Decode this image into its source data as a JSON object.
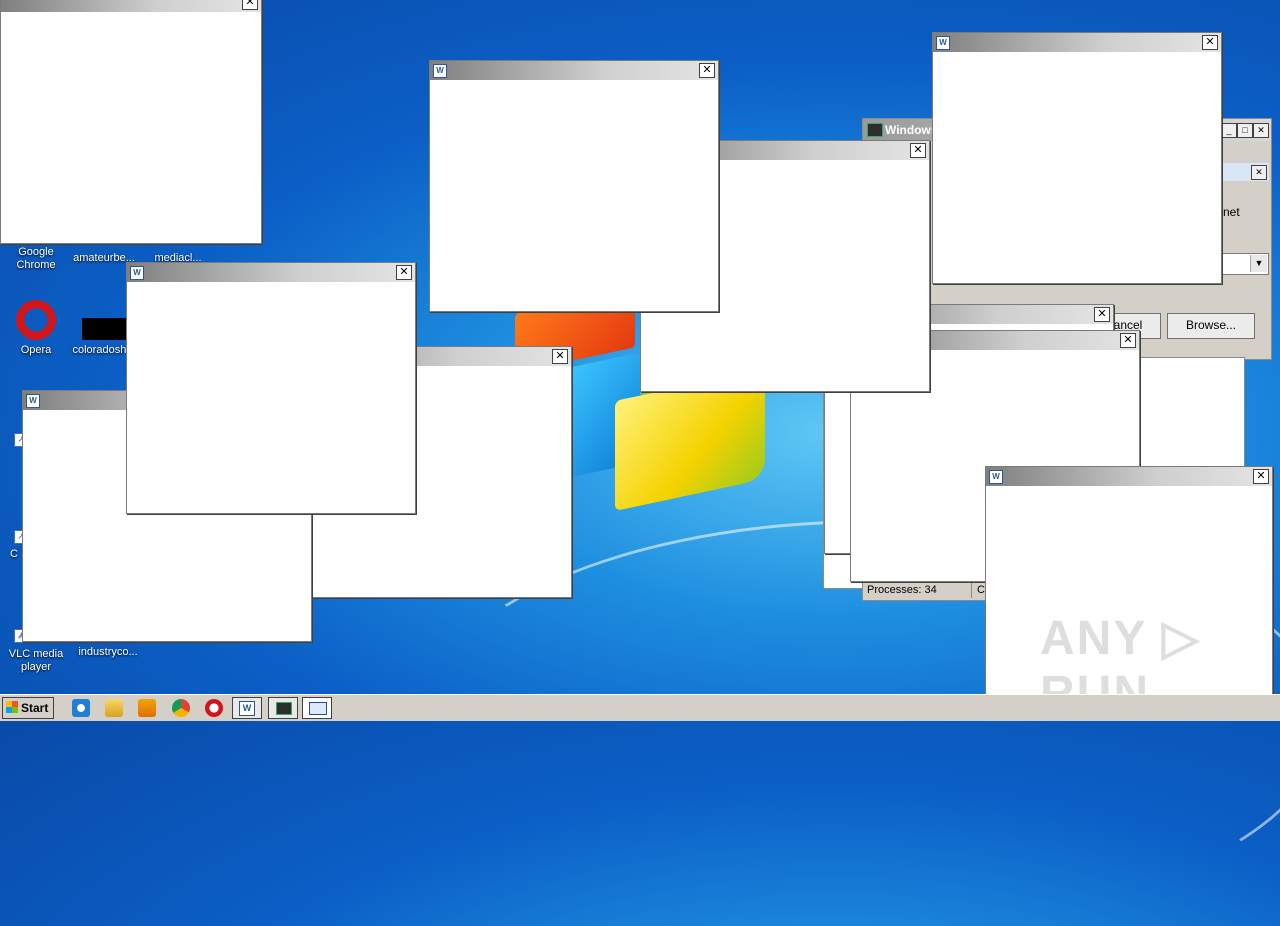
{
  "desktop": {
    "icons": [
      {
        "label": "Google Chrome",
        "icon": "chrome-icon"
      },
      {
        "label": "amateurbe...",
        "icon": "file-icon"
      },
      {
        "label": "mediacl...",
        "icon": "file-icon"
      },
      {
        "label": "Opera",
        "icon": "opera-icon"
      },
      {
        "label": "coloradosh...",
        "icon": "file-icon"
      },
      {
        "label": "VLC media player",
        "icon": "vlc-icon"
      },
      {
        "label": "industryco...",
        "icon": "file-icon"
      },
      {
        "label": "C",
        "icon": "shortcut-icon"
      }
    ]
  },
  "task_manager": {
    "title": "Windows",
    "browse_button": "Browse...",
    "cancel_button": "ancel",
    "partial_text": "rnet",
    "status_processes": "Processes: 34",
    "status_cpu": "CF"
  },
  "popup_close_glyph": "✕",
  "taskbar": {
    "start_label": "Start"
  },
  "watermark": "ANY ▷ RUN"
}
